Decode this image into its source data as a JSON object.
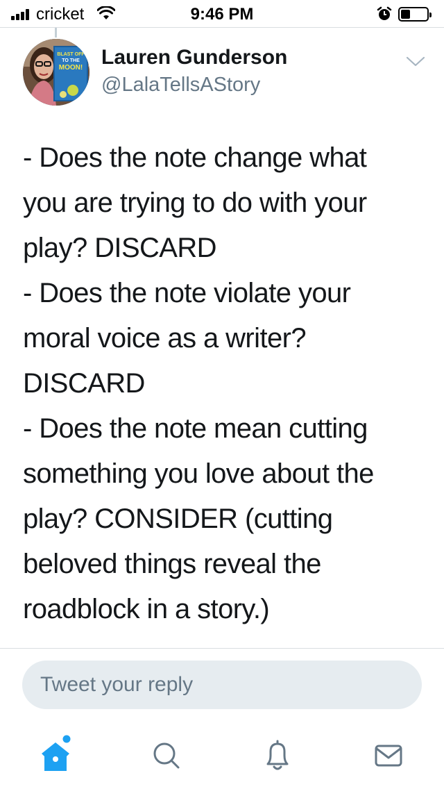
{
  "status_bar": {
    "carrier": "cricket",
    "time": "9:46 PM",
    "signal_icon": "signal-bars-icon",
    "wifi_icon": "wifi-icon",
    "alarm_icon": "alarm-clock-icon",
    "battery_icon": "battery-icon",
    "battery_level": 0.35
  },
  "tweet": {
    "author": {
      "name": "Lauren Gunderson",
      "handle": "@LalaTellsAStory",
      "avatar_book_text": [
        "BLAST OFF",
        "TO THE",
        "MOON!"
      ]
    },
    "text_lines": [
      "- Does the note change what",
      "you are trying to do with your",
      "play? DISCARD",
      "- Does the note violate your",
      "moral voice as a writer?",
      "DISCARD",
      "- Does the note mean cutting",
      "something you love about the",
      "play? CONSIDER (cutting",
      "beloved things  reveal the",
      "roadblock in a story.)"
    ],
    "more_icon": "chevron-down-icon"
  },
  "reply": {
    "placeholder": "Tweet your reply"
  },
  "tab_bar": {
    "tabs": [
      {
        "icon": "home-icon",
        "active": true,
        "has_notification_dot": true
      },
      {
        "icon": "search-icon",
        "active": false
      },
      {
        "icon": "bell-icon",
        "active": false
      },
      {
        "icon": "mail-icon",
        "active": false
      }
    ]
  },
  "colors": {
    "accent": "#1da1f2",
    "text": "#14171a",
    "secondary_text": "#657786",
    "reply_background": "#e6ecf0"
  }
}
